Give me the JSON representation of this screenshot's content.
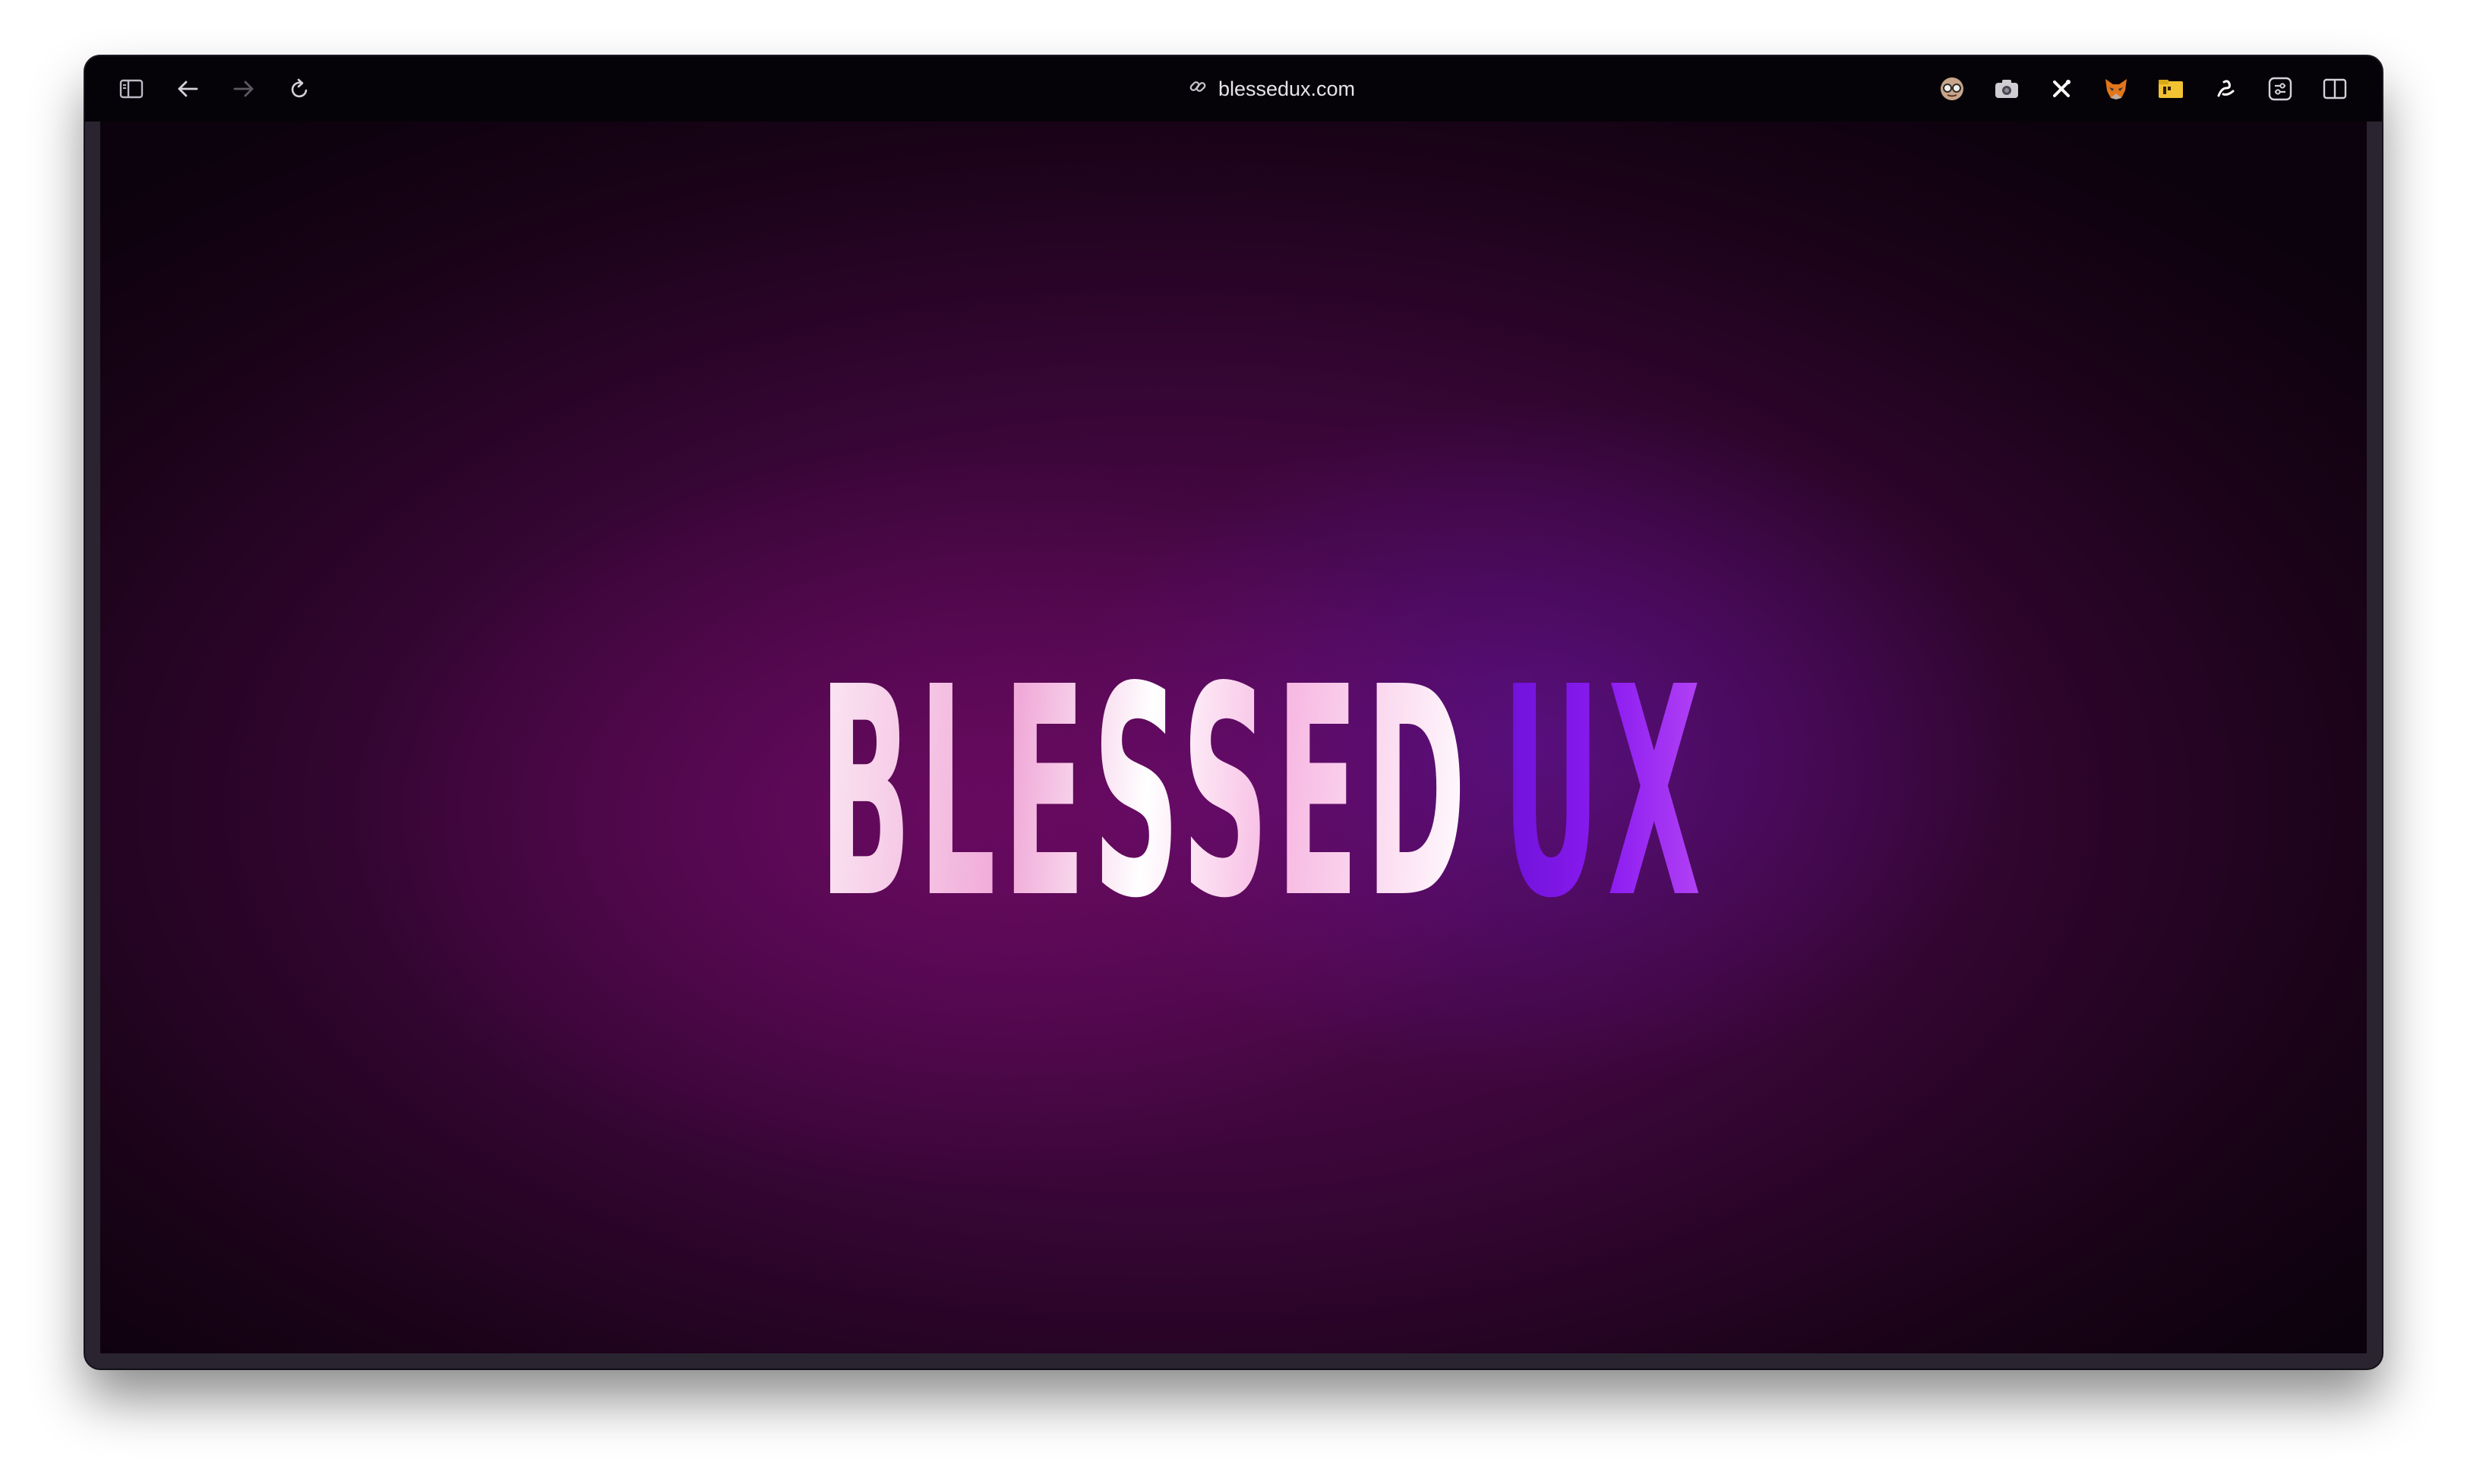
{
  "browser": {
    "url": "blessedux.com",
    "toolbar_icons": [
      "sidebar-icon",
      "back-arrow-icon",
      "forward-arrow-icon",
      "reload-icon"
    ],
    "extension_icons": [
      "glasses-face-icon",
      "camera-icon",
      "x-close-icon",
      "fox-icon",
      "folder-icon",
      "script-icon",
      "sliders-icon",
      "split-view-icon"
    ]
  },
  "page": {
    "logo_word": "BLESSED",
    "logo_accent": "UX",
    "colors": {
      "background": "#3a0638",
      "logo_word": "#f3b6df",
      "logo_accent": "#7a16e6"
    }
  }
}
